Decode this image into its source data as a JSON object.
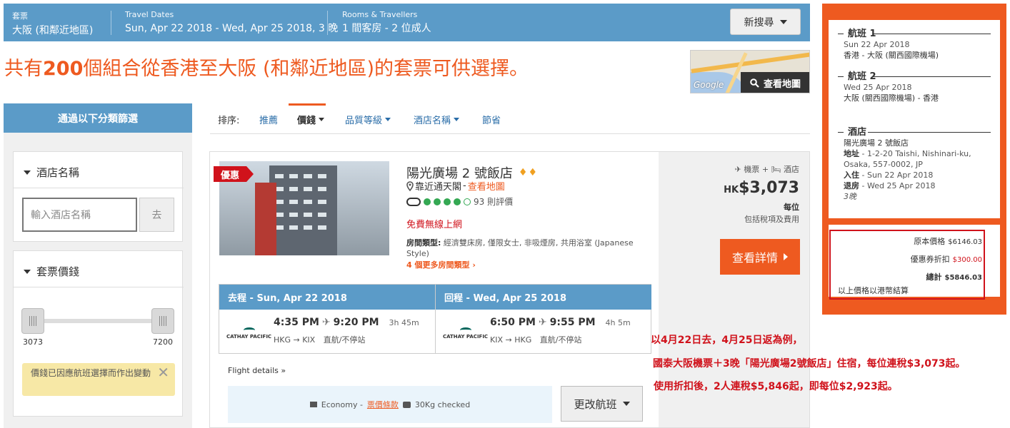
{
  "search": {
    "package_label": "套票",
    "package_value": "大阪 (和鄰近地區)",
    "dates_label": "Travel Dates",
    "dates_value": "Sun, Apr 22 2018 - Wed, Apr 25 2018, 3 晚",
    "rooms_label": "Rooms & Travellers",
    "rooms_value": "1 間客房 - 2 位成人",
    "new_search": "新搜尋"
  },
  "headline": {
    "prefix": "共有",
    "count": "200",
    "suffix": "個組合從香港至大阪 (和鄰近地區)的套票可供選擇。"
  },
  "map": {
    "google": "Google",
    "view_map": "查看地圖"
  },
  "filters": {
    "header": "通過以下分類篩選",
    "hotel_name_title": "酒店名稱",
    "hotel_name_placeholder": "輸入酒店名稱",
    "go": "去",
    "price_title": "套票價錢",
    "price_min": "3073",
    "price_max": "7200",
    "notice": "價錢已因應航班選擇而作出變動"
  },
  "sort": {
    "label": "排序:",
    "options": [
      "推薦",
      "價錢",
      "品質等級",
      "酒店名稱",
      "節省"
    ]
  },
  "result": {
    "promo": "優惠",
    "hotel_name": "陽光廣場 2 號飯店",
    "diamonds": "♦♦",
    "location": "靠近通天閣",
    "location_link": "查看地圖",
    "reviews": "93 則評價",
    "rating": 4,
    "wifi": "免費無線上網",
    "room_label": "房間類型:",
    "room_desc": "經濟雙床房, 僅限女士, 非吸煙房, 共用浴室 (Japanese Style)",
    "more_rooms": "4 個更多房間類型",
    "bundle_flight": "機票",
    "bundle_hotel": "酒店",
    "currency": "HK",
    "price": "$3,073",
    "per_person": "每位",
    "includes": "包括稅項及費用",
    "details_button": "查看詳情",
    "outbound": {
      "header": "去程 - Sun, Apr 22 2018",
      "airline": "CATHAY PACIFIC",
      "depart": "4:35 PM",
      "arrive": "9:20 PM",
      "duration": "3h 45m",
      "route": "HKG → KIX",
      "stops": "直航/不停站"
    },
    "inbound": {
      "header": "回程 - Wed, Apr 25 2018",
      "airline": "CATHAY PACIFIC",
      "depart": "6:50 PM",
      "arrive": "9:55 PM",
      "duration": "4h 5m",
      "route": "KIX → HKG",
      "stops": "直航/不停站"
    },
    "flight_details": "Flight details",
    "cabin": "Economy -",
    "fare_terms": "票價條款",
    "baggage": "30Kg checked",
    "change_flight": "更改航班"
  },
  "itinerary": {
    "flight1_title": "航班 1",
    "flight1_date": "Sun 22 Apr 2018",
    "flight1_route": "香港 - 大阪 (關西國際機場)",
    "flight2_title": "航班 2",
    "flight2_date": "Wed 25 Apr 2018",
    "flight2_route": "大阪 (關西國際機場) - 香港",
    "hotel_title": "酒店",
    "hotel_name": "陽光廣場 2 號飯店",
    "address_label": "地址",
    "address": " - 1-2-20 Taishi, Nishinari-ku, Osaka, 557-0002, JP",
    "checkin_label": "入住",
    "checkin": " - Sun 22 Apr 2018",
    "checkout_label": "退房",
    "checkout": " - Wed 25 Apr 2018",
    "nights": "3晚",
    "original_label": "原本價格",
    "original_value": "$6146.03",
    "coupon_label": "優惠券折扣",
    "coupon_value": "$300.00",
    "total_label": "總計",
    "total_value": "$5846.03",
    "currency_note": "以上價格以港幣結算"
  },
  "annotation": {
    "line1": "以4月22日去，4月25日返為例，",
    "line2": "國泰大阪機票＋3晚「陽光廣場2號飯店」住宿，每位連稅$3,073起。",
    "line3": "使用折扣後，2人連稅$5,846起，即每位$2,923起。"
  },
  "colors": {
    "blue": "#5b9bc8",
    "orange": "#ee5a20",
    "red": "#d0121b",
    "link": "#2a6da8"
  }
}
